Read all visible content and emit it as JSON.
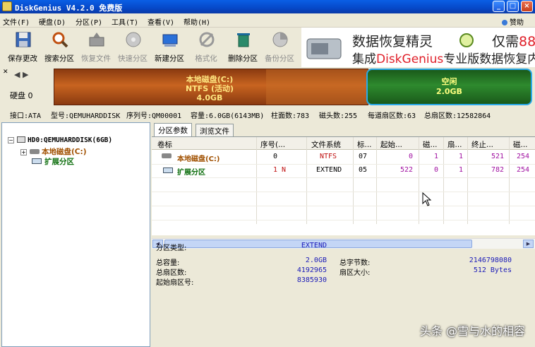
{
  "window": {
    "title": "DiskGenius V4.2.0 免费版"
  },
  "menu": [
    "文件(F)",
    "硬盘(D)",
    "分区(P)",
    "工具(T)",
    "查看(V)",
    "帮助(H)"
  ],
  "sponsor_label": "赞助",
  "toolbar": [
    {
      "label": "保存更改",
      "icon": "save-icon",
      "enabled": true
    },
    {
      "label": "搜索分区",
      "icon": "search-icon",
      "enabled": true
    },
    {
      "label": "恢复文件",
      "icon": "recover-file-icon",
      "enabled": false
    },
    {
      "label": "快速分区",
      "icon": "quick-partition-icon",
      "enabled": false
    },
    {
      "label": "新建分区",
      "icon": "new-partition-icon",
      "enabled": true
    },
    {
      "label": "格式化",
      "icon": "format-icon",
      "enabled": false
    },
    {
      "label": "删除分区",
      "icon": "delete-partition-icon",
      "enabled": true
    },
    {
      "label": "备份分区",
      "icon": "backup-partition-icon",
      "enabled": false
    }
  ],
  "banner": {
    "line1": "数据恢复精灵",
    "line2_pre": "集成",
    "line2_red": "DiskGenius",
    "line2_post": "专业版数据恢复内",
    "price_text": "仅需",
    "price_red": "88"
  },
  "disk": {
    "label": "硬盘 0",
    "partitions": [
      {
        "name": "本地磁盘(C:)",
        "fs": "NTFS (活动)",
        "size": "4.0GB"
      },
      {
        "name": "空闲",
        "size": "2.0GB"
      }
    ],
    "info": {
      "interface": "接口:ATA",
      "model": "型号:QEMUHARDDISK",
      "serial": "序列号:QM00001",
      "capacity": "容量:6.0GB(6143MB)",
      "cylinders": "柱面数:783",
      "heads": "磁头数:255",
      "sectors_per_track": "每道扇区数:63",
      "total_sectors": "总扇区数:12582864"
    }
  },
  "tree": {
    "disk": "HD0:QEMUHARDDISK(6GB)",
    "items": [
      "本地磁盘(C:)",
      "扩展分区"
    ]
  },
  "tabs": [
    "分区参数",
    "浏览文件"
  ],
  "table": {
    "headers": [
      "卷标",
      "序号(...",
      "文件系统",
      "标...",
      "起始...",
      "磁...",
      "扇...",
      "终止...",
      "磁..."
    ],
    "rows": [
      {
        "name": "本地磁盘(C:)",
        "cells": [
          "0",
          "NTFS",
          "07",
          "0",
          "1",
          "1",
          "521",
          "254"
        ]
      },
      {
        "name": "扩展分区",
        "cells": [
          "1 N",
          "EXTEND",
          "05",
          "522",
          "0",
          "1",
          "782",
          "254"
        ]
      }
    ]
  },
  "details": {
    "type_label": "分区类型:",
    "type_value": "EXTEND",
    "capacity_label": "总容量:",
    "capacity_value": "2.0GB",
    "total_bytes_label": "总字节数:",
    "total_bytes_value": "2146798080",
    "sectors_label": "总扇区数:",
    "sectors_value": "4192965",
    "sector_size_label": "扇区大小:",
    "sector_size_value": "512 Bytes",
    "start_sector_label": "起始扇区号:",
    "start_sector_value": "8385930"
  },
  "watermark": "头条 @雪与水的相容",
  "colors": {
    "title_blue": "#0648c8",
    "partition_c": "#c86420",
    "free_space": "#2e8a2e",
    "value_blue": "#1a1ab8",
    "price_red": "#e0202a"
  }
}
